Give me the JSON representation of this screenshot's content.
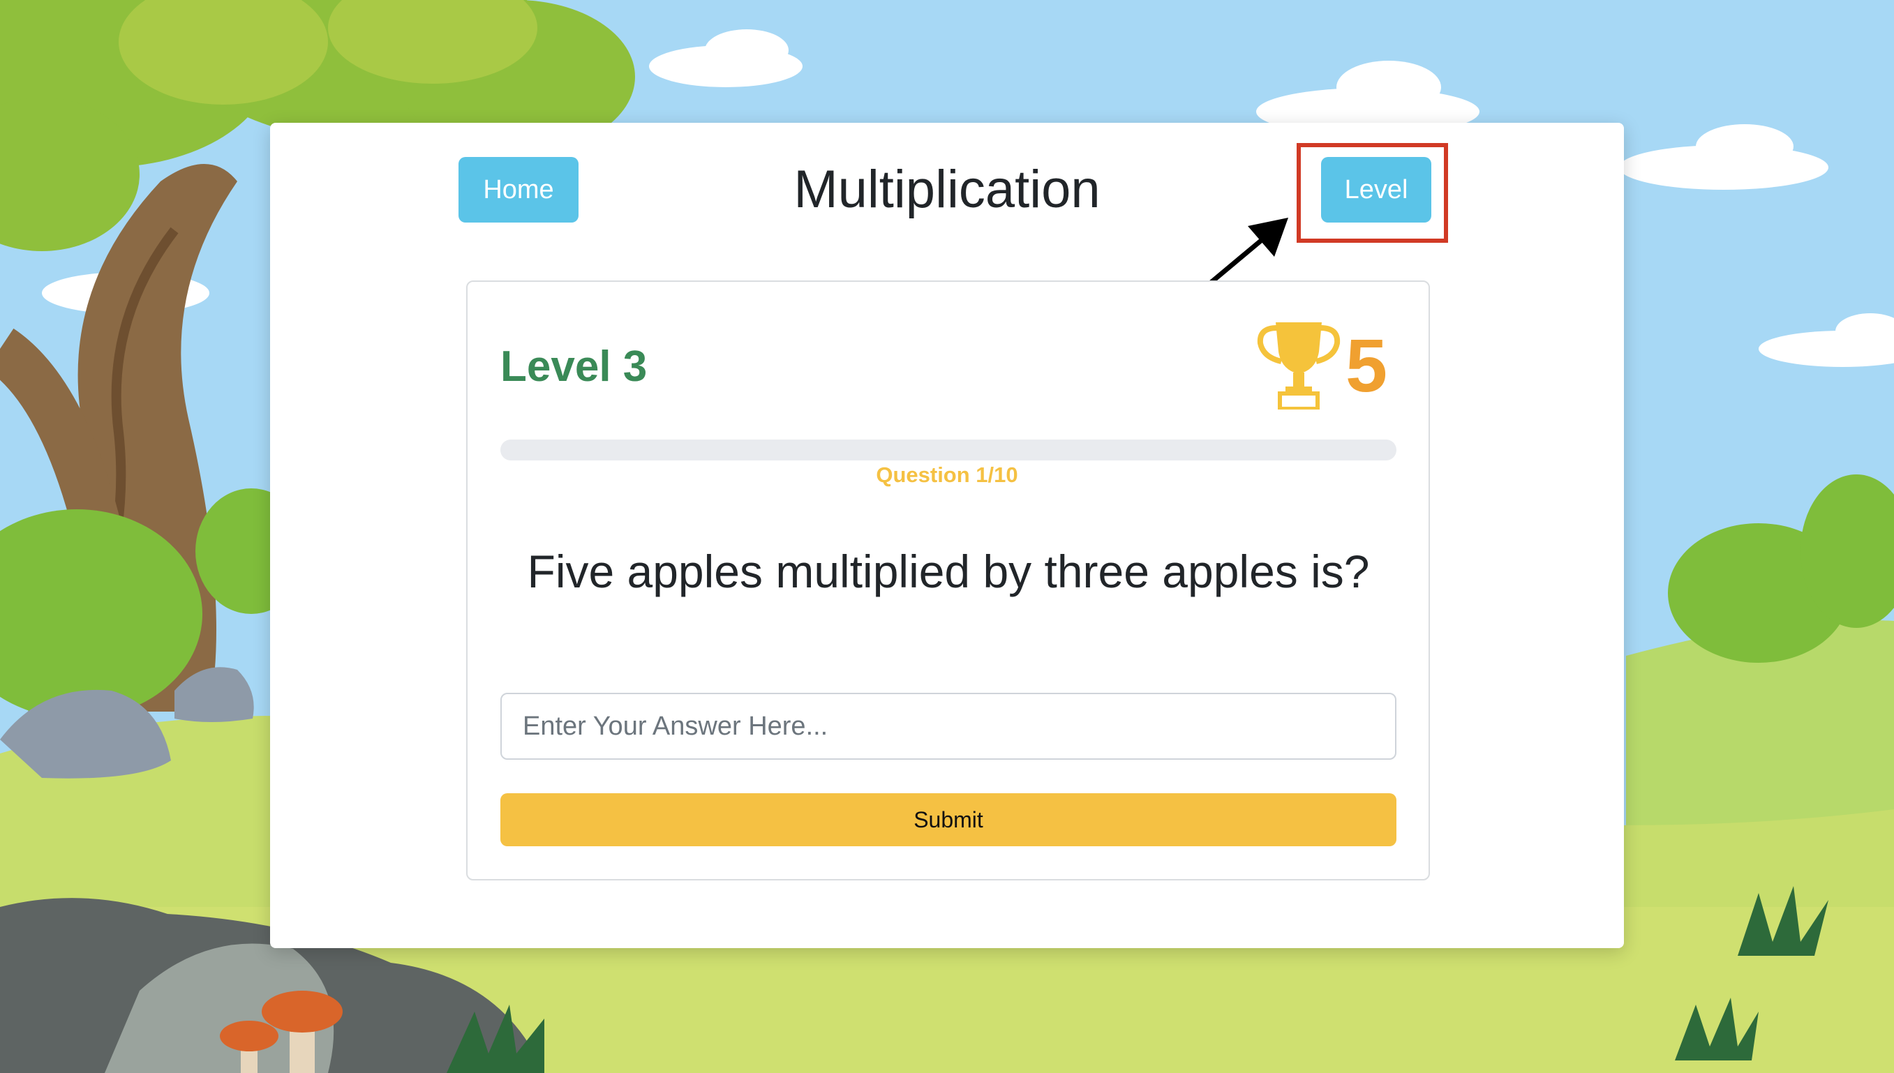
{
  "header": {
    "home_label": "Home",
    "title": "Multiplication",
    "level_label": "Level"
  },
  "quiz": {
    "level_title": "Level 3",
    "score": "5",
    "progress_fraction": 0.0,
    "question_counter": "Question 1/10",
    "question_text": "Five apples multiplied by three apples is?",
    "answer_placeholder": "Enter Your Answer Here...",
    "answer_value": "",
    "submit_label": "Submit"
  },
  "colors": {
    "button_blue": "#5bc4e8",
    "level_green": "#3a8a57",
    "score_orange": "#f0a030",
    "accent_yellow": "#f5c143",
    "highlight_red": "#d13a25"
  },
  "icons": {
    "trophy": "trophy-icon",
    "annotation": "arrow-pointer-icon"
  }
}
